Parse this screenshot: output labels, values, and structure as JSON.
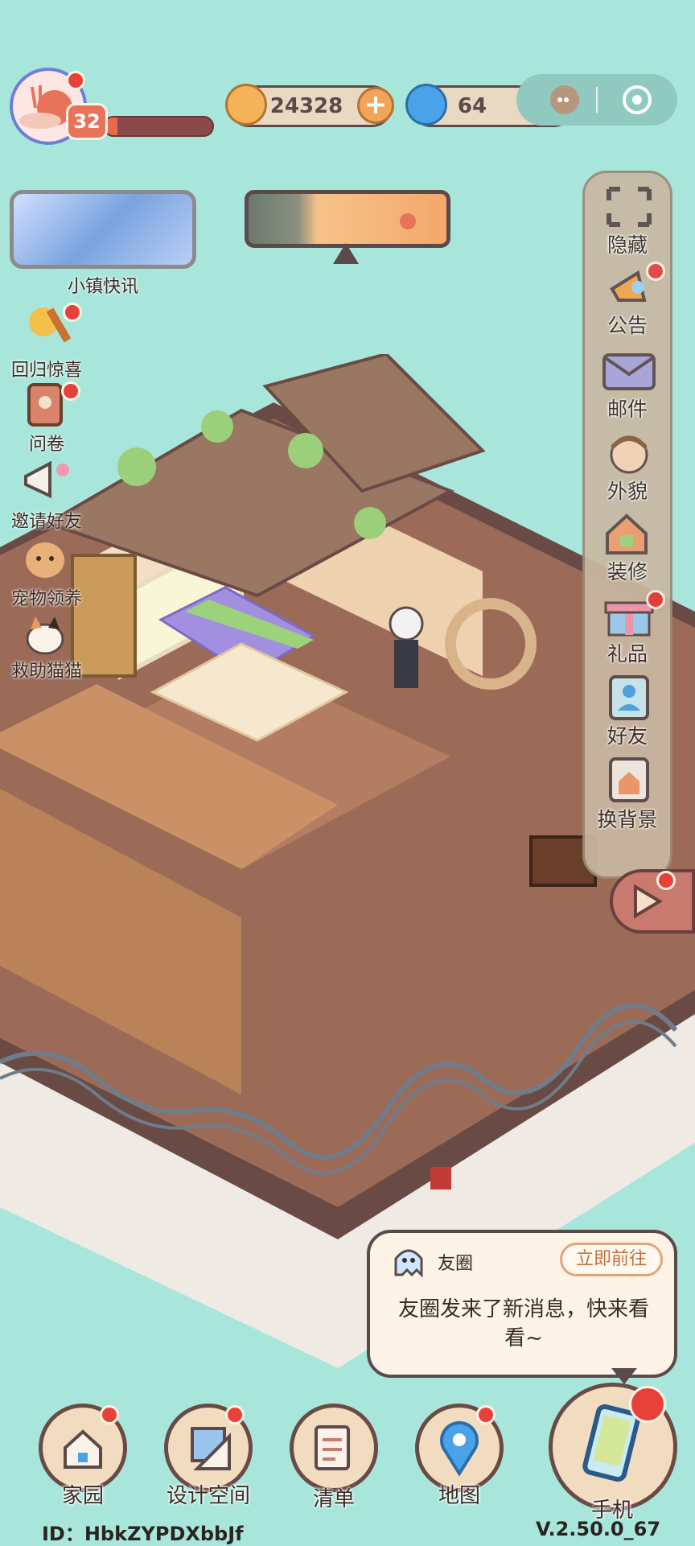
{
  "player": {
    "level": "32",
    "xp_progress": 0.12,
    "avatar_icon": "snail-avatar-icon"
  },
  "currency": {
    "coins": "24328",
    "gems": "64"
  },
  "news": {
    "label": "小镇快讯"
  },
  "left_menu": [
    {
      "label": "回归惊喜",
      "icon": "gift-hammer-icon",
      "badge": true
    },
    {
      "label": "问卷",
      "icon": "questionnaire-icon",
      "badge": true
    },
    {
      "label": "邀请好友",
      "icon": "megaphone-icon",
      "badge": false
    },
    {
      "label": "宠物领养",
      "icon": "dog-icon",
      "badge": false
    },
    {
      "label": "救助猫猫",
      "icon": "cat-icon",
      "badge": false
    }
  ],
  "right_menu": [
    {
      "label": "隐藏",
      "icon": "hide-icon",
      "badge": false
    },
    {
      "label": "公告",
      "icon": "announcement-icon",
      "badge": true
    },
    {
      "label": "邮件",
      "icon": "mail-icon",
      "badge": false
    },
    {
      "label": "外貌",
      "icon": "appearance-icon",
      "badge": false
    },
    {
      "label": "装修",
      "icon": "decorate-icon",
      "badge": false
    },
    {
      "label": "礼品",
      "icon": "gift-icon",
      "badge": true
    },
    {
      "label": "好友",
      "icon": "friends-icon",
      "badge": false
    },
    {
      "label": "换背景",
      "icon": "background-icon",
      "badge": false
    }
  ],
  "chat": {
    "source": "友圈",
    "action": "立即前往",
    "message_line1": "友圈发来了新消息，快来看",
    "message_line2": "看~"
  },
  "bottom_nav": [
    {
      "label": "家园",
      "icon": "home-icon",
      "badge": true
    },
    {
      "label": "设计空间",
      "icon": "design-icon",
      "badge": true
    },
    {
      "label": "清单",
      "icon": "list-icon",
      "badge": false
    },
    {
      "label": "地图",
      "icon": "map-pin-icon",
      "badge": true
    },
    {
      "label": "手机",
      "icon": "phone-icon",
      "badge": true
    }
  ],
  "footer": {
    "id": "ID：HbkZYPDXbbJf",
    "version": "V.2.50.0_67"
  },
  "colors": {
    "background": "#a8e6dc",
    "badge": "#e8413a",
    "outline": "#5c4a4a"
  }
}
